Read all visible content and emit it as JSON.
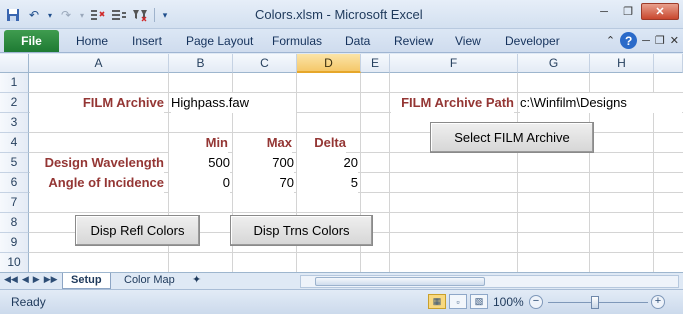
{
  "window": {
    "title": "Colors.xlsm  -  Microsoft Excel"
  },
  "quick_access": [
    "save-icon",
    "undo-icon",
    "redo-icon",
    "insert-rows-icon",
    "delete-rows-icon",
    "filter-icon",
    "customize-icon"
  ],
  "ribbon": {
    "file": "File",
    "tabs": [
      "Home",
      "Insert",
      "Page Layout",
      "Formulas",
      "Data",
      "Review",
      "View",
      "Developer"
    ],
    "help": "?"
  },
  "grid": {
    "columns": [
      "A",
      "B",
      "C",
      "D",
      "E",
      "F",
      "G",
      "H"
    ],
    "selected_column": "D",
    "rows": [
      "1",
      "2",
      "3",
      "4",
      "5",
      "6",
      "7",
      "8",
      "9",
      "10"
    ]
  },
  "cells": {
    "film_archive_label": "FILM Archive",
    "film_archive_value": "Highpass.faw",
    "film_archive_path_label": "FILM Archive Path",
    "film_archive_path_value": "c:\\Winfilm\\Designs",
    "hdr_min": "Min",
    "hdr_max": "Max",
    "hdr_delta": "Delta",
    "design_wavelength_label": "Design Wavelength",
    "design_wavelength_min": "500",
    "design_wavelength_max": "700",
    "design_wavelength_delta": "20",
    "angle_label": "Angle of Incidence",
    "angle_min": "0",
    "angle_max": "70",
    "angle_delta": "5"
  },
  "buttons": {
    "select_archive": "Select FILM Archive",
    "disp_refl": "Disp Refl Colors",
    "disp_trns": "Disp Trns Colors"
  },
  "sheets": {
    "tabs": [
      "Setup",
      "Color Map"
    ],
    "active": "Setup"
  },
  "status": {
    "ready": "Ready",
    "zoom": "100%"
  }
}
